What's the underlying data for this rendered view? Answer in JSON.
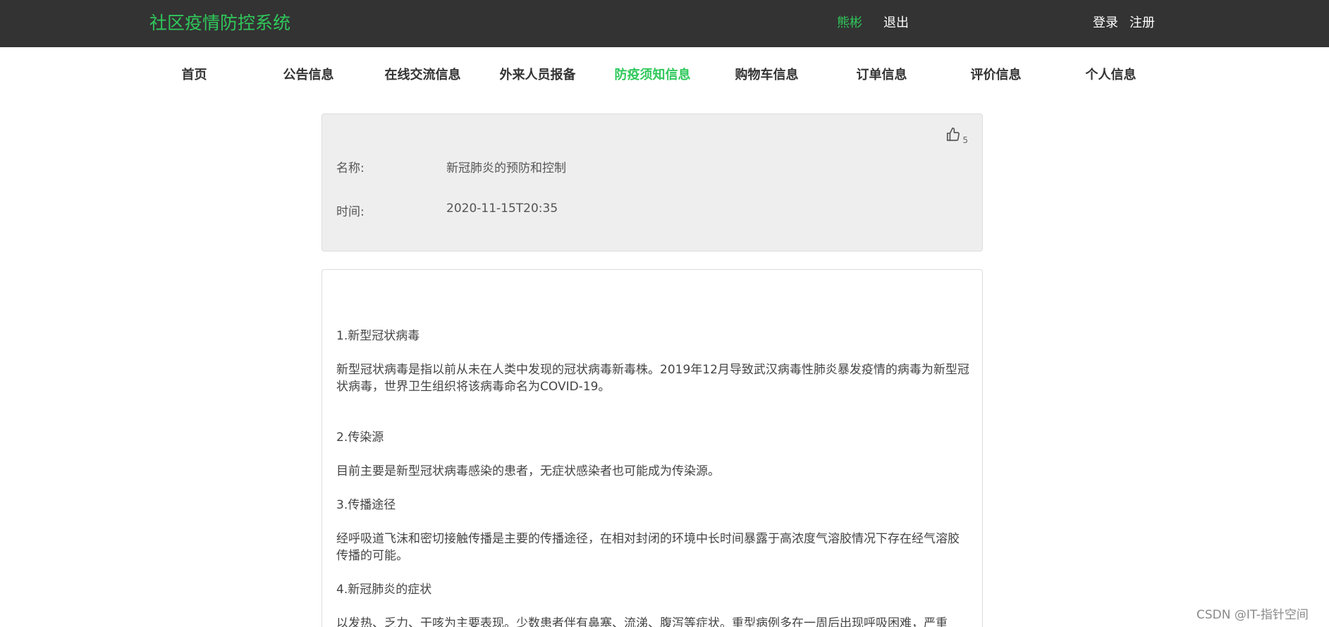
{
  "header": {
    "brand": "社区疫情防控系统",
    "user_name": "熊彬",
    "logout": "退出",
    "login": "登录",
    "register": "注册"
  },
  "nav": {
    "items": [
      {
        "label": "首页"
      },
      {
        "label": "公告信息"
      },
      {
        "label": "在线交流信息"
      },
      {
        "label": "外来人员报备"
      },
      {
        "label": "防疫须知信息",
        "active": true
      },
      {
        "label": "购物车信息"
      },
      {
        "label": "订单信息"
      },
      {
        "label": "评价信息"
      },
      {
        "label": "个人信息"
      }
    ]
  },
  "detail": {
    "like_count": "5",
    "name_label": "名称:",
    "name_value": "新冠肺炎的预防和控制",
    "time_label": "时间:",
    "time_value": "2020-11-15T20:35"
  },
  "article": {
    "s1_title": "1.新型冠状病毒",
    "s1_body": "新型冠状病毒是指以前从未在人类中发现的冠状病毒新毒株。2019年12月导致武汉病毒性肺炎暴发疫情的病毒为新型冠状病毒，世界卫生组织将该病毒命名为COVID-19。",
    "s2_title": "2.传染源",
    "s2_body": "目前主要是新型冠状病毒感染的患者，无症状感染者也可能成为传染源。",
    "s3_title": "3.传播途径",
    "s3_body": "经呼吸道飞沫和密切接触传播是主要的传播途径，在相对封闭的环境中长时间暴露于高浓度气溶胶情况下存在经气溶胶传播的可能。",
    "s4_title": "4.新冠肺炎的症状",
    "s4_body": "以发热、乏力、干咳为主要表现。少数患者伴有鼻塞、流涕、腹泻等症状。重型病例多在一周后出现呼吸困难，严重"
  },
  "watermark": "CSDN @IT-指针空间",
  "colors": {
    "accent": "#2fc85b",
    "topbar": "#333333",
    "panel": "#eeeeee"
  }
}
